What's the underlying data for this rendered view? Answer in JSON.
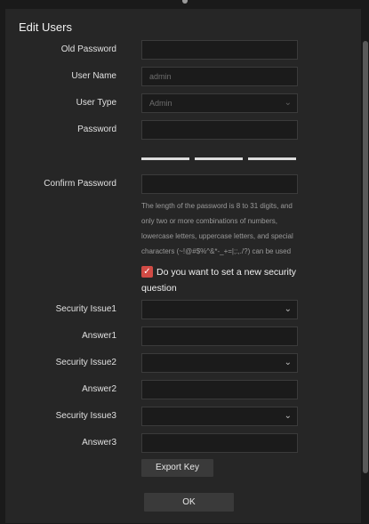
{
  "dialog": {
    "title": "Edit Users"
  },
  "form": {
    "old_password": {
      "label": "Old Password",
      "value": ""
    },
    "user_name": {
      "label": "User Name",
      "value": "admin"
    },
    "user_type": {
      "label": "User Type",
      "value": "Admin"
    },
    "password": {
      "label": "Password",
      "value": ""
    },
    "confirm_password": {
      "label": "Confirm Password",
      "value": ""
    },
    "password_hint": "The length of the password is 8 to 31 digits, and only two or more combinations of numbers, lowercase letters, uppercase letters, and special characters (~!@#$%^&*-_+=|;:,./?) can be used",
    "security_question_checkbox": {
      "checked": true,
      "label": "Do you want to set a new security question"
    },
    "security_issue1": {
      "label": "Security Issue1",
      "value": ""
    },
    "answer1": {
      "label": "Answer1",
      "value": ""
    },
    "security_issue2": {
      "label": "Security Issue2",
      "value": ""
    },
    "answer2": {
      "label": "Answer2",
      "value": ""
    },
    "security_issue3": {
      "label": "Security Issue3",
      "value": ""
    },
    "answer3": {
      "label": "Answer3",
      "value": ""
    }
  },
  "buttons": {
    "export_key": "Export Key",
    "ok": "OK"
  },
  "icons": {
    "chevron": "chevron-down-icon",
    "check": "checkmark-icon"
  },
  "colors": {
    "checkbox_accent": "#d14b45",
    "background": "#262626"
  }
}
